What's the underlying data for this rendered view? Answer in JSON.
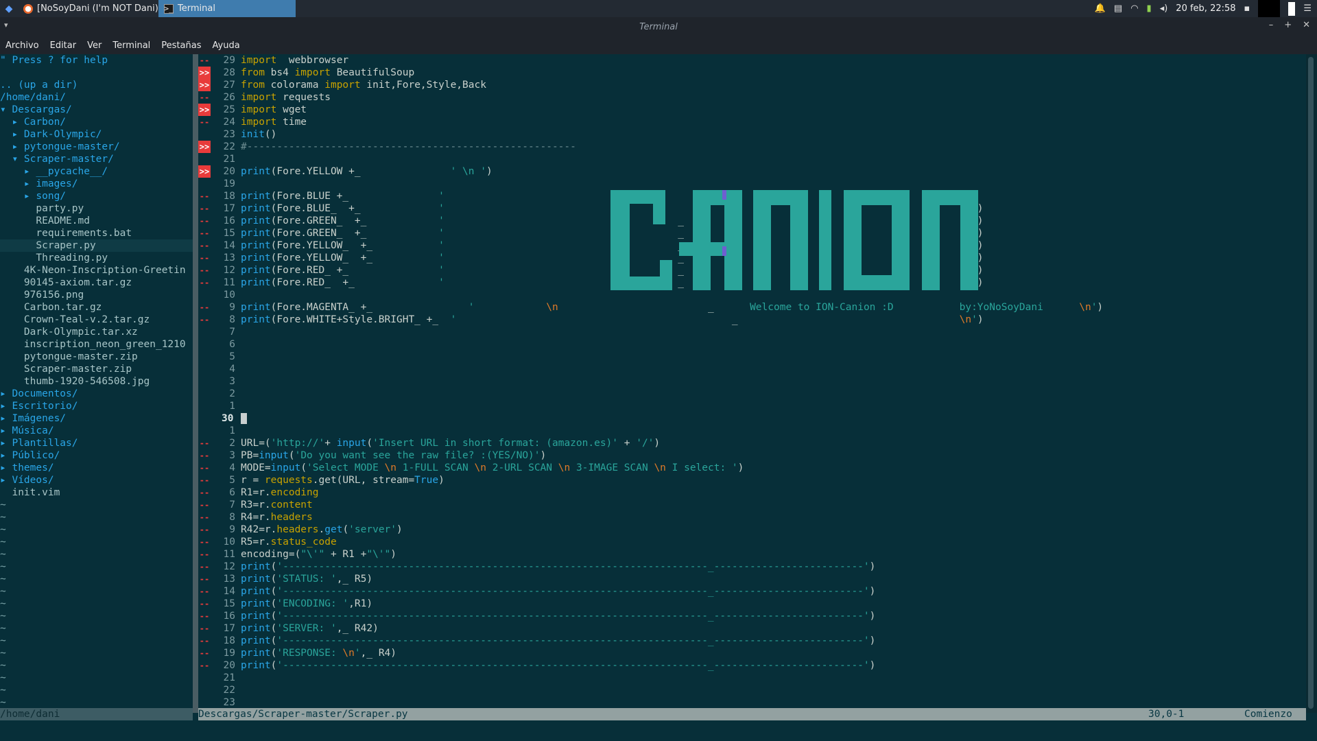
{
  "taskbar": {
    "tasks": [
      {
        "label": "[NoSoyDani (I'm NOT Dani) -...",
        "icon": "firefox-icon"
      },
      {
        "label": "Terminal",
        "icon": "terminal-icon",
        "active": true
      }
    ],
    "clock": "20 feb, 22:58"
  },
  "window": {
    "title": "Terminal"
  },
  "menu": [
    "Archivo",
    "Editar",
    "Ver",
    "Terminal",
    "Pestañas",
    "Ayuda"
  ],
  "tree": {
    "lines": [
      {
        "t": "\" Press ? for help",
        "c": "c-help"
      },
      {
        "t": "",
        "c": ""
      },
      {
        "t": ".. (up a dir)",
        "c": "c-blue"
      },
      {
        "t": "/home/dani/",
        "c": "c-path"
      },
      {
        "t": "▾ Descargas/",
        "c": "c-blue"
      },
      {
        "t": "  ▸ Carbon/",
        "c": "c-blue"
      },
      {
        "t": "  ▸ Dark-Olympic/",
        "c": "c-blue"
      },
      {
        "t": "  ▸ pytongue-master/",
        "c": "c-blue"
      },
      {
        "t": "  ▾ Scraper-master/",
        "c": "c-blue"
      },
      {
        "t": "    ▸ __pycache__/",
        "c": "c-blue"
      },
      {
        "t": "    ▸ images/",
        "c": "c-blue"
      },
      {
        "t": "    ▸ song/",
        "c": "c-blue"
      },
      {
        "t": "      party.py",
        "c": "c-file"
      },
      {
        "t": "      README.md",
        "c": "c-file"
      },
      {
        "t": "      requirements.bat",
        "c": "c-file"
      },
      {
        "t": "      Scraper.py",
        "c": "c-file",
        "cur": true
      },
      {
        "t": "      Threading.py",
        "c": "c-file"
      },
      {
        "t": "    4K-Neon-Inscription-Greetin",
        "c": "c-file"
      },
      {
        "t": "    90145-axiom.tar.gz",
        "c": "c-file"
      },
      {
        "t": "    976156.png",
        "c": "c-file"
      },
      {
        "t": "    Carbon.tar.gz",
        "c": "c-file"
      },
      {
        "t": "    Crown-Teal-v.2.tar.gz",
        "c": "c-file"
      },
      {
        "t": "    Dark-Olympic.tar.xz",
        "c": "c-file"
      },
      {
        "t": "    inscription_neon_green_1210",
        "c": "c-file"
      },
      {
        "t": "    pytongue-master.zip",
        "c": "c-file"
      },
      {
        "t": "    Scraper-master.zip",
        "c": "c-file"
      },
      {
        "t": "    thumb-1920-546508.jpg",
        "c": "c-file"
      },
      {
        "t": "▸ Documentos/",
        "c": "c-blue"
      },
      {
        "t": "▸ Escritorio/",
        "c": "c-blue"
      },
      {
        "t": "▸ Imágenes/",
        "c": "c-blue"
      },
      {
        "t": "▸ Música/",
        "c": "c-blue"
      },
      {
        "t": "▸ Plantillas/",
        "c": "c-blue"
      },
      {
        "t": "▸ Público/",
        "c": "c-blue"
      },
      {
        "t": "▸ themes/",
        "c": "c-blue"
      },
      {
        "t": "▸ Vídeos/",
        "c": "c-blue"
      },
      {
        "t": "  init.vim",
        "c": "c-file"
      }
    ],
    "tilde_count": 17,
    "status": "/home/dani"
  },
  "editor": {
    "lines": [
      {
        "s": "--",
        "n": "29",
        "code": [
          [
            "kw",
            "import"
          ],
          [
            "",
            "  webbrowser"
          ]
        ]
      },
      {
        "s": ">>",
        "n": "28",
        "code": [
          [
            "kw",
            "from"
          ],
          [
            "",
            " bs4 "
          ],
          [
            "kw",
            "import"
          ],
          [
            "",
            " BeautifulSoup"
          ]
        ]
      },
      {
        "s": ">>",
        "n": "27",
        "code": [
          [
            "kw",
            "from"
          ],
          [
            "",
            " colorama "
          ],
          [
            "kw",
            "import"
          ],
          [
            "",
            " init,Fore,Style,Back"
          ]
        ]
      },
      {
        "s": "--",
        "n": "26",
        "code": [
          [
            "kw",
            "import"
          ],
          [
            "",
            " requests"
          ]
        ]
      },
      {
        "s": ">>",
        "n": "25",
        "code": [
          [
            "kw",
            "import"
          ],
          [
            "",
            " wget"
          ]
        ]
      },
      {
        "s": "--",
        "n": "24",
        "code": [
          [
            "kw",
            "import"
          ],
          [
            "",
            " time"
          ]
        ]
      },
      {
        "s": "",
        "n": "23",
        "code": [
          [
            "fn",
            "init"
          ],
          [
            "",
            "()"
          ]
        ]
      },
      {
        "s": ">>",
        "n": "22",
        "code": [
          [
            "cmt",
            "#-------------------------------------------------------"
          ]
        ]
      },
      {
        "s": "",
        "n": "21",
        "code": []
      },
      {
        "s": ">>",
        "n": "20",
        "code": [
          [
            "fn",
            "print"
          ],
          [
            "",
            "(Fore.YELLOW +_               "
          ],
          [
            "str",
            "' \\n '"
          ],
          [
            "",
            ")"
          ]
        ]
      },
      {
        "s": "",
        "n": "19",
        "code": []
      },
      {
        "s": "--",
        "n": "18",
        "code": [
          [
            "fn",
            "print"
          ],
          [
            "",
            "(Fore.BLUE +_               "
          ],
          [
            "str",
            "'"
          ],
          [
            "",
            "                                                                                       ')"
          ]
        ]
      },
      {
        "s": "--",
        "n": "17",
        "code": [
          [
            "fn",
            "print"
          ],
          [
            "",
            "(Fore.BLUE_  +_             "
          ],
          [
            "str",
            "'"
          ],
          [
            "",
            "                                                                                        ')"
          ]
        ]
      },
      {
        "s": "--",
        "n": "16",
        "code": [
          [
            "fn",
            "print"
          ],
          [
            "",
            "(Fore.GREEN_  +_            "
          ],
          [
            "str",
            "'"
          ],
          [
            "",
            "                                       _                                                ')"
          ]
        ]
      },
      {
        "s": "--",
        "n": "15",
        "code": [
          [
            "fn",
            "print"
          ],
          [
            "",
            "(Fore.GREEN_  +_            "
          ],
          [
            "str",
            "'"
          ],
          [
            "",
            "                                       _                                                ')"
          ]
        ]
      },
      {
        "s": "--",
        "n": "14",
        "code": [
          [
            "fn",
            "print"
          ],
          [
            "",
            "(Fore.YELLOW_  +_           "
          ],
          [
            "str",
            "'"
          ],
          [
            "",
            "                                       _                                                ')"
          ]
        ]
      },
      {
        "s": "--",
        "n": "13",
        "code": [
          [
            "fn",
            "print"
          ],
          [
            "",
            "(Fore.YELLOW_  +_           "
          ],
          [
            "str",
            "'"
          ],
          [
            "",
            "                                       _                                                ')"
          ]
        ]
      },
      {
        "s": "--",
        "n": "12",
        "code": [
          [
            "fn",
            "print"
          ],
          [
            "",
            "(Fore.RED_ +_               "
          ],
          [
            "str",
            "'"
          ],
          [
            "",
            "                                       _                                                ')"
          ]
        ]
      },
      {
        "s": "--",
        "n": "11",
        "code": [
          [
            "fn",
            "print"
          ],
          [
            "",
            "(Fore.RED_  +_              "
          ],
          [
            "str",
            "'"
          ],
          [
            "",
            "                                       _                                                ')"
          ]
        ]
      },
      {
        "s": "",
        "n": "10",
        "code": []
      },
      {
        "s": "--",
        "n": "9",
        "code": [
          [
            "fn",
            "print"
          ],
          [
            "",
            "(Fore.MAGENTA_ +_                "
          ],
          [
            "str",
            "'"
          ],
          [
            "",
            "            "
          ],
          [
            "esc",
            "\\n"
          ],
          [
            "",
            "                         _      "
          ],
          [
            "str",
            "Welcome to ION-Canion :D           by:YoNoSoyDani      "
          ],
          [
            "esc",
            "\\n"
          ],
          [
            "str",
            "'"
          ],
          [
            "",
            ")"
          ]
        ]
      },
      {
        "s": "--",
        "n": "8",
        "code": [
          [
            "fn",
            "print"
          ],
          [
            "",
            "(Fore.WHITE+Style.BRIGHT_ +_  "
          ],
          [
            "str",
            "'"
          ],
          [
            "",
            "                                              _                                     "
          ],
          [
            "esc",
            "\\n"
          ],
          [
            "str",
            "'"
          ],
          [
            "",
            ")"
          ]
        ]
      },
      {
        "s": "",
        "n": "7",
        "code": []
      },
      {
        "s": "",
        "n": "6",
        "code": []
      },
      {
        "s": "",
        "n": "5",
        "code": []
      },
      {
        "s": "",
        "n": "4",
        "code": []
      },
      {
        "s": "",
        "n": "3",
        "code": []
      },
      {
        "s": "",
        "n": "2",
        "code": []
      },
      {
        "s": "",
        "n": "1",
        "code": []
      },
      {
        "s": "",
        "n": "30",
        "cur": true,
        "code": [
          [
            "cursor",
            ""
          ]
        ]
      },
      {
        "s": "",
        "n": "1",
        "code": []
      },
      {
        "s": "--",
        "n": "2",
        "code": [
          [
            "",
            "URL=("
          ],
          [
            "str",
            "'http://'"
          ],
          [
            "",
            "+ "
          ],
          [
            "fn",
            "input"
          ],
          [
            "",
            "("
          ],
          [
            "str",
            "'Insert URL in short format: (amazon.es)'"
          ],
          [
            "",
            " + "
          ],
          [
            "str",
            "'/'"
          ],
          [
            "",
            ")"
          ]
        ]
      },
      {
        "s": "--",
        "n": "3",
        "code": [
          [
            "",
            "PB="
          ],
          [
            "fn",
            "input"
          ],
          [
            "",
            "("
          ],
          [
            "str",
            "'Do you want see the raw file? :(YES/NO)'"
          ],
          [
            "",
            ")"
          ]
        ]
      },
      {
        "s": "--",
        "n": "4",
        "code": [
          [
            "",
            "MODE="
          ],
          [
            "fn",
            "input"
          ],
          [
            "",
            "("
          ],
          [
            "str",
            "'Select MODE "
          ],
          [
            "esc",
            "\\n"
          ],
          [
            "str",
            " 1-FULL SCAN "
          ],
          [
            "esc",
            "\\n"
          ],
          [
            "str",
            " 2-URL SCAN "
          ],
          [
            "esc",
            "\\n"
          ],
          [
            "str",
            " 3-IMAGE SCAN "
          ],
          [
            "esc",
            "\\n"
          ],
          [
            "str",
            " I select: '"
          ],
          [
            "",
            ")"
          ]
        ]
      },
      {
        "s": "--",
        "n": "5",
        "code": [
          [
            "",
            "r = "
          ],
          [
            "kw",
            "requests"
          ],
          [
            "",
            ".get(URL, stream="
          ],
          [
            "fn",
            "True"
          ],
          [
            "",
            ")"
          ]
        ]
      },
      {
        "s": "--",
        "n": "6",
        "code": [
          [
            "",
            "R1=r."
          ],
          [
            "kw",
            "encoding"
          ]
        ]
      },
      {
        "s": "--",
        "n": "7",
        "code": [
          [
            "",
            "R3=r."
          ],
          [
            "kw",
            "content"
          ]
        ]
      },
      {
        "s": "--",
        "n": "8",
        "code": [
          [
            "",
            "R4=r."
          ],
          [
            "kw",
            "headers"
          ]
        ]
      },
      {
        "s": "--",
        "n": "9",
        "code": [
          [
            "",
            "R42=r."
          ],
          [
            "kw",
            "headers"
          ],
          [
            "",
            "."
          ],
          [
            "fn",
            "get"
          ],
          [
            "",
            "("
          ],
          [
            "str",
            "'server'"
          ],
          [
            "",
            ")"
          ]
        ]
      },
      {
        "s": "--",
        "n": "10",
        "code": [
          [
            "",
            "R5=r."
          ],
          [
            "kw",
            "status_code"
          ]
        ]
      },
      {
        "s": "--",
        "n": "11",
        "code": [
          [
            "",
            "encoding=("
          ],
          [
            "str",
            "\"\\'\""
          ],
          [
            "",
            " + R1 +"
          ],
          [
            "str",
            "\"\\'\""
          ],
          [
            "",
            ")"
          ]
        ]
      },
      {
        "s": "--",
        "n": "12",
        "code": [
          [
            "fn",
            "print"
          ],
          [
            "",
            "("
          ],
          [
            "str",
            "'-----------------------------------------------------------------------_-------------------------'"
          ],
          [
            "",
            ")"
          ]
        ]
      },
      {
        "s": "--",
        "n": "13",
        "code": [
          [
            "fn",
            "print"
          ],
          [
            "",
            "("
          ],
          [
            "str",
            "'STATUS: '"
          ],
          [
            "",
            ",_ R5)"
          ]
        ]
      },
      {
        "s": "--",
        "n": "14",
        "code": [
          [
            "fn",
            "print"
          ],
          [
            "",
            "("
          ],
          [
            "str",
            "'-----------------------------------------------------------------------_-------------------------'"
          ],
          [
            "",
            ")"
          ]
        ]
      },
      {
        "s": "--",
        "n": "15",
        "code": [
          [
            "fn",
            "print"
          ],
          [
            "",
            "("
          ],
          [
            "str",
            "'ENCODING: '"
          ],
          [
            "",
            ",R1)"
          ]
        ]
      },
      {
        "s": "--",
        "n": "16",
        "code": [
          [
            "fn",
            "print"
          ],
          [
            "",
            "("
          ],
          [
            "str",
            "'-----------------------------------------------------------------------_-------------------------'"
          ],
          [
            "",
            ")"
          ]
        ]
      },
      {
        "s": "--",
        "n": "17",
        "code": [
          [
            "fn",
            "print"
          ],
          [
            "",
            "("
          ],
          [
            "str",
            "'SERVER: '"
          ],
          [
            "",
            ",_ R42)"
          ]
        ]
      },
      {
        "s": "--",
        "n": "18",
        "code": [
          [
            "fn",
            "print"
          ],
          [
            "",
            "("
          ],
          [
            "str",
            "'-----------------------------------------------------------------------_-------------------------'"
          ],
          [
            "",
            ")"
          ]
        ]
      },
      {
        "s": "--",
        "n": "19",
        "code": [
          [
            "fn",
            "print"
          ],
          [
            "",
            "("
          ],
          [
            "str",
            "'RESPONSE: "
          ],
          [
            "esc",
            "\\n"
          ],
          [
            "str",
            "'"
          ],
          [
            "",
            ",_ R4)"
          ]
        ]
      },
      {
        "s": "--",
        "n": "20",
        "code": [
          [
            "fn",
            "print"
          ],
          [
            "",
            "("
          ],
          [
            "str",
            "'-----------------------------------------------------------------------_-------------------------'"
          ],
          [
            "",
            ")"
          ]
        ]
      },
      {
        "s": "",
        "n": "21",
        "code": []
      },
      {
        "s": "",
        "n": "22",
        "code": []
      },
      {
        "s": "",
        "n": "23",
        "code": []
      }
    ],
    "status": {
      "file": "Descargas/Scraper-master/Scraper.py",
      "pos": "30,0-1",
      "pct": "Comienzo"
    }
  },
  "colors": {
    "bg": "#072f39",
    "accent": "#3f7cae",
    "ascii_art": "#2aa59b"
  }
}
